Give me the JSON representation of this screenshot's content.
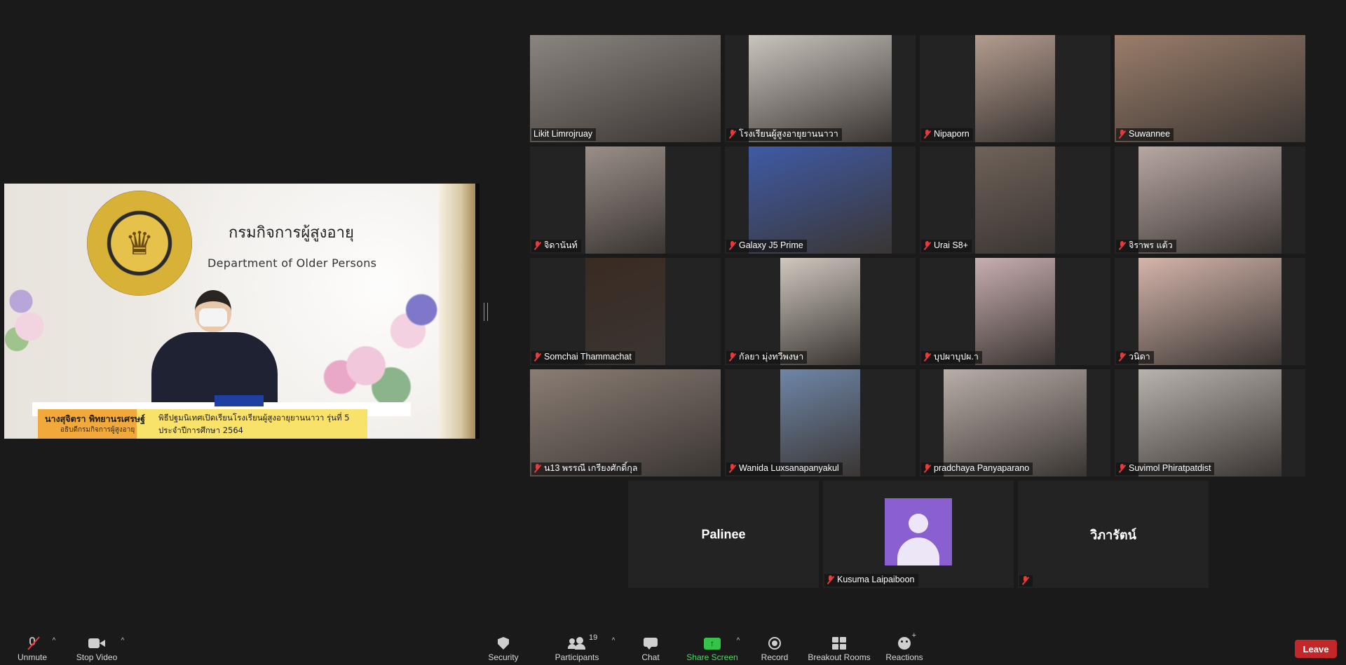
{
  "share": {
    "org_th": "กรมกิจการผู้สูงอายุ",
    "org_en": "Department of Older Persons",
    "caption_name": "นางสุจิตรา พิทยานรเศรษฐ์",
    "caption_role": "อธิบดีกรมกิจการผู้สูงอายุ",
    "caption_line1": "พิธีปฐมนิเทศเปิดเรียนโรงเรียนผู้สูงอายุยานนาวา รุ่นที่ 5",
    "caption_line2": "ประจำปีการศึกษา 2564"
  },
  "participants": [
    {
      "name": "Likit Limrojruay",
      "muted": false,
      "active": true,
      "bg": "#8b8580"
    },
    {
      "name": "โรงเรียนผู้สูงอายุยานนาวา",
      "muted": true,
      "bg": "#c9c4bd"
    },
    {
      "name": "Nipaporn",
      "muted": true,
      "bg": "#b49c8f"
    },
    {
      "name": "Suwannee",
      "muted": true,
      "bg": "#9a7d6a"
    },
    {
      "name": "จิดานันท์",
      "muted": true,
      "bg": "#9a8f88"
    },
    {
      "name": "Galaxy J5 Prime",
      "muted": true,
      "bg": "#3f5aa6"
    },
    {
      "name": "Urai S8+",
      "muted": true,
      "bg": "#6f6259"
    },
    {
      "name": "จิราพร แต้ว",
      "muted": true,
      "bg": "#b8a7a3"
    },
    {
      "name": "Somchai Thammachat",
      "muted": true,
      "bg": "#3a2b22"
    },
    {
      "name": "กัลยา มุ่งทวีพงษา",
      "muted": true,
      "bg": "#cfc8bf"
    },
    {
      "name": "บุปผาบุปผ.า",
      "muted": true,
      "bg": "#c9aeb0"
    },
    {
      "name": "วนิดา",
      "muted": true,
      "bg": "#d4b5ab"
    },
    {
      "name": "น13 พรรณี เกรียงศักดิ์กุล",
      "muted": true,
      "bg": "#8a7d74"
    },
    {
      "name": "Wanida Luxsanapanyakul",
      "muted": true,
      "bg": "#6e86a8"
    },
    {
      "name": "pradchaya Panyaparano",
      "muted": true,
      "bg": "#b9aea8"
    },
    {
      "name": "Suvimol Phiratpatdist",
      "muted": true,
      "bg": "#b8b3ad"
    },
    {
      "name": "Palinee",
      "muted": false,
      "bg": "#232323",
      "no_video": true
    },
    {
      "name": "Kusuma Laipaiboon",
      "muted": true,
      "bg": "#232323",
      "avatar": true
    },
    {
      "name": "วิภารัตน์",
      "muted": true,
      "bg": "#232323",
      "no_video": true
    }
  ],
  "toolbar": {
    "unmute": "Unmute",
    "stop_video": "Stop Video",
    "security": "Security",
    "participants": "Participants",
    "participants_count": "19",
    "chat": "Chat",
    "share_screen": "Share Screen",
    "record": "Record",
    "breakout_rooms": "Breakout Rooms",
    "reactions": "Reactions",
    "leave": "Leave",
    "share_color": "#33c449",
    "leave_color": "#c2282a"
  },
  "colors": {
    "background": "#1a1a1a",
    "active_speaker": "#d9e46c",
    "muted": "#e23c3c"
  }
}
